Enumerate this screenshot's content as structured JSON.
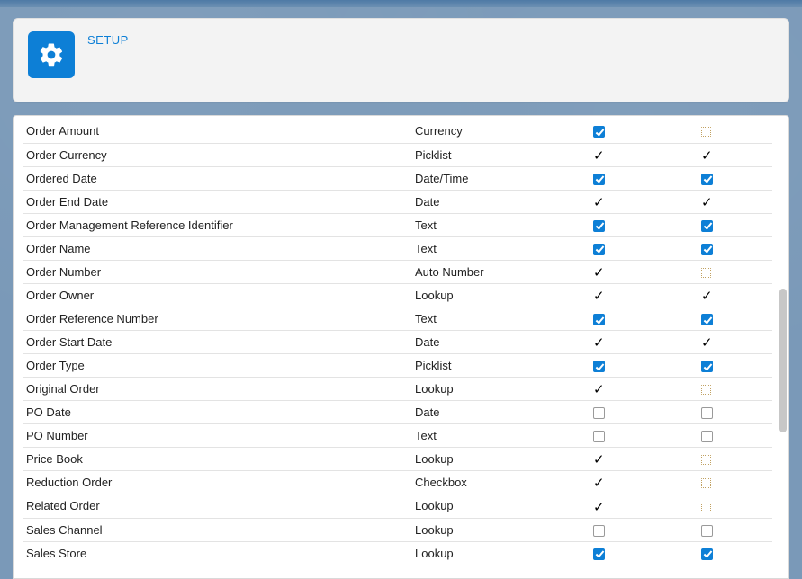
{
  "header": {
    "setup_label": "SETUP"
  },
  "fields": [
    {
      "label": "Order Amount",
      "type": "Currency",
      "c1": "cb_blue",
      "c2": "dotted"
    },
    {
      "label": "Order Currency",
      "type": "Picklist",
      "c1": "tick",
      "c2": "tick"
    },
    {
      "label": "Ordered Date",
      "type": "Date/Time",
      "c1": "cb_blue",
      "c2": "cb_blue"
    },
    {
      "label": "Order End Date",
      "type": "Date",
      "c1": "tick",
      "c2": "tick"
    },
    {
      "label": "Order Management Reference Identifier",
      "type": "Text",
      "c1": "cb_blue",
      "c2": "cb_blue"
    },
    {
      "label": "Order Name",
      "type": "Text",
      "c1": "cb_blue",
      "c2": "cb_blue"
    },
    {
      "label": "Order Number",
      "type": "Auto Number",
      "c1": "tick",
      "c2": "dotted"
    },
    {
      "label": "Order Owner",
      "type": "Lookup",
      "c1": "tick",
      "c2": "tick"
    },
    {
      "label": "Order Reference Number",
      "type": "Text",
      "c1": "cb_blue",
      "c2": "cb_blue"
    },
    {
      "label": "Order Start Date",
      "type": "Date",
      "c1": "tick",
      "c2": "tick"
    },
    {
      "label": "Order Type",
      "type": "Picklist",
      "c1": "cb_blue",
      "c2": "cb_blue"
    },
    {
      "label": "Original Order",
      "type": "Lookup",
      "c1": "tick",
      "c2": "dotted"
    },
    {
      "label": "PO Date",
      "type": "Date",
      "c1": "cb_empty",
      "c2": "cb_empty"
    },
    {
      "label": "PO Number",
      "type": "Text",
      "c1": "cb_empty",
      "c2": "cb_empty"
    },
    {
      "label": "Price Book",
      "type": "Lookup",
      "c1": "tick",
      "c2": "dotted"
    },
    {
      "label": "Reduction Order",
      "type": "Checkbox",
      "c1": "tick",
      "c2": "dotted"
    },
    {
      "label": "Related Order",
      "type": "Lookup",
      "c1": "tick",
      "c2": "dotted"
    },
    {
      "label": "Sales Channel",
      "type": "Lookup",
      "c1": "cb_empty",
      "c2": "cb_empty"
    },
    {
      "label": "Sales Store",
      "type": "Lookup",
      "c1": "cb_blue",
      "c2": "cb_blue"
    }
  ]
}
